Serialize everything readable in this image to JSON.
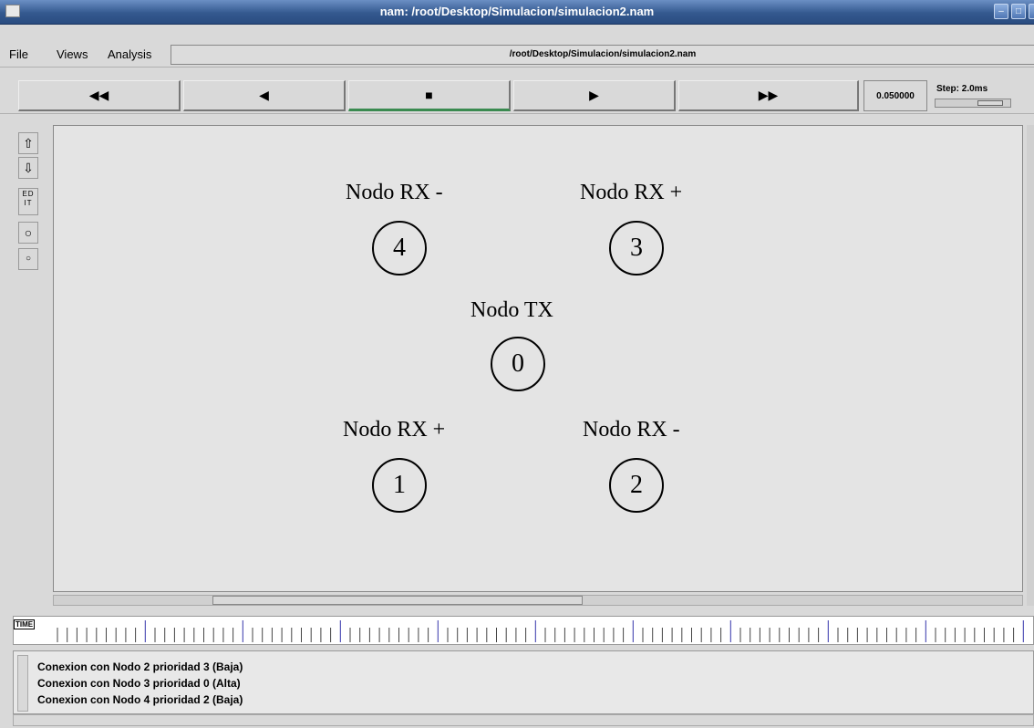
{
  "window": {
    "title": "nam: /root/Desktop/Simulacion/simulacion2.nam"
  },
  "menu": {
    "file": "File",
    "views": "Views",
    "analysis": "Analysis",
    "filepath": "/root/Desktop/Simulacion/simulacion2.nam"
  },
  "toolbar": {
    "rewind": "◀◀",
    "back": "◀",
    "stop": "■",
    "play": "▶",
    "fast_forward": "▶▶",
    "time": "0.050000",
    "step_label": "Step: 2.0ms"
  },
  "tools": {
    "zoom_in": "⇧",
    "zoom_out": "⇩",
    "edit": "ED IT"
  },
  "nodes": [
    {
      "id": "4",
      "label": "Nodo RX -"
    },
    {
      "id": "3",
      "label": "Nodo RX +"
    },
    {
      "id": "0",
      "label": "Nodo TX"
    },
    {
      "id": "1",
      "label": "Nodo RX +"
    },
    {
      "id": "2",
      "label": "Nodo RX -"
    }
  ],
  "timeline": {
    "label": "TIME"
  },
  "log": [
    "Conexion con Nodo 2 prioridad 3 (Baja)",
    "Conexion con Nodo 3 prioridad 0 (Alta)",
    "Conexion con Nodo 4 prioridad 2 (Baja)"
  ]
}
